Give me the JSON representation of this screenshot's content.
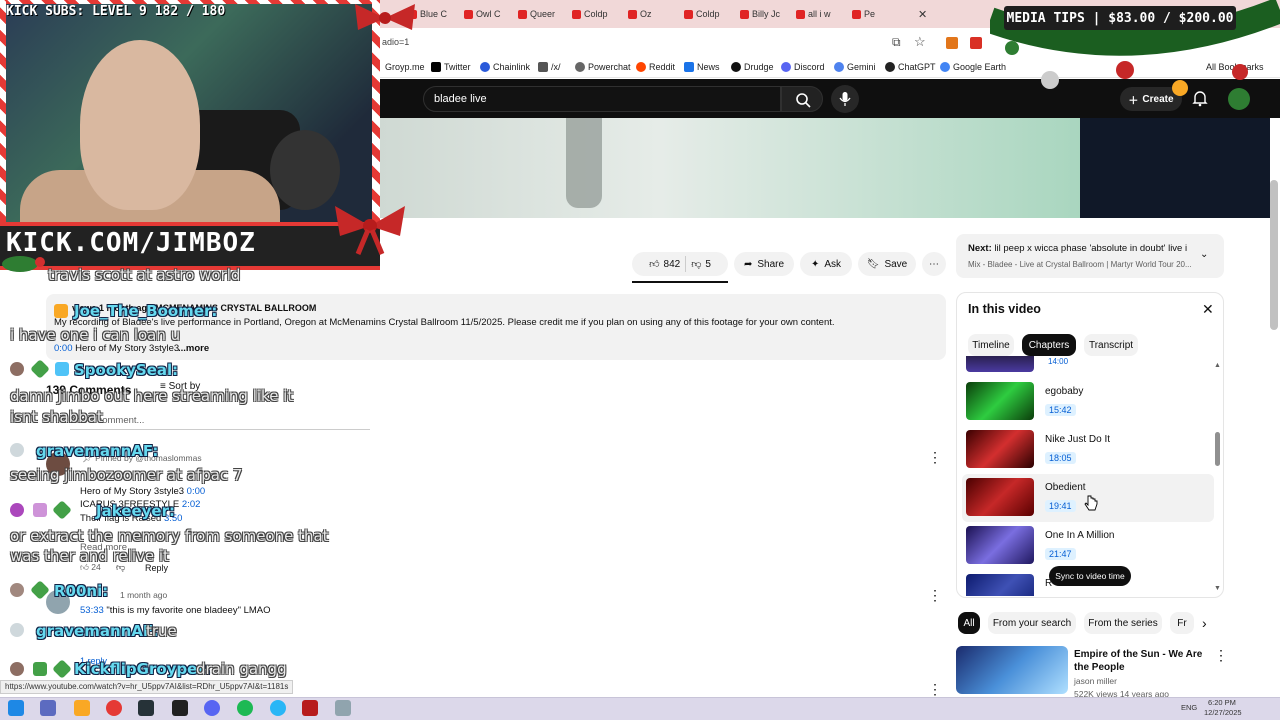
{
  "stream_overlay": {
    "kick_subs": "KICK SUBS: LEVEL 9 182 / 180",
    "banner_url": "KICK.COM/JIMBOZ",
    "media_tips": "MEDIA TIPS | $83.00 / $200.00"
  },
  "browser": {
    "tabs": [
      "Blue C",
      "Owl C",
      "Queer",
      "Coldp",
      "Oz",
      "Coldp",
      "Billy Jc",
      "all i w",
      "Pe"
    ],
    "address_fragment": "adio=1",
    "bookmarks": [
      "Groyp.me",
      "Twitter",
      "Chainlink",
      "/x/",
      "Powerchat",
      "Reddit",
      "News",
      "Drudge",
      "Discord",
      "Gemini",
      "ChatGPT",
      "Google Earth",
      "All Bookmarks"
    ],
    "status_url": "https://www.youtube.com/watch?v=hr_U5ppv7AI&list=RDhr_U5ppv7AI&t=1181s"
  },
  "youtube": {
    "search_value": "bladee live",
    "create_label": "Create",
    "actions": {
      "likes": "842",
      "dislikes": "5",
      "share": "Share",
      "ask": "Ask",
      "save": "Save"
    },
    "description": {
      "header": "views  1 month ago  MCMENAMINS CRYSTAL BALLROOM",
      "line1": "My recording of Bladee's live performance in Portland, Oregon at McMenamins Crystal Ballroom 11/5/2025. Please credit me if you plan on using any of this footage for your own content.",
      "timestamp": "0:00",
      "track": "Hero of My Story 3style3",
      "more": "...more"
    },
    "comments_header": {
      "count": "139 Comments",
      "sort": "Sort by",
      "add_placeholder": "Add a comment..."
    },
    "comments": [
      {
        "pinned": "Pinned by @thomaslommas",
        "lines": [
          {
            "text": "Hero of My Story 3style3 ",
            "time": "0:00"
          },
          {
            "text": "ICARUS 3FREESTYLE ",
            "time": "2:02"
          },
          {
            "text": "Their flag is Raised ",
            "time": "3:50"
          }
        ],
        "read_more": "Read more",
        "likes": "24",
        "reply": "Reply"
      },
      {
        "meta": "1 month ago",
        "time": "53:33",
        "text": "\"this is my favorite one bladeey\" LMAO",
        "replies": "1 reply"
      }
    ],
    "up_next": {
      "prefix": "Next:",
      "title": "lil peep x wicca phase 'absolute in doubt' live i...",
      "subtitle": "Mix - Bladee - Live at Crystal Ballroom | Martyr World Tour 20..."
    },
    "panel": {
      "title": "In this video",
      "tabs": [
        "Timeline",
        "Chapters",
        "Transcript"
      ],
      "active_tab": "Chapters",
      "top_partial_time": "14:00",
      "chapters": [
        {
          "title": "egobaby",
          "time": "15:42"
        },
        {
          "title": "Nike Just Do It",
          "time": "18:05"
        },
        {
          "title": "Obedient",
          "time": "19:41"
        },
        {
          "title": "One In A Million",
          "time": "21:47"
        },
        {
          "title": "R",
          "time": ""
        }
      ],
      "sync_tooltip": "Sync to video time"
    },
    "filter_chips": [
      "All",
      "From your search",
      "From the series",
      "Fr"
    ],
    "recommendation": {
      "title": "Empire of the Sun - We Are the People",
      "channel": "jason miller",
      "meta": "522K views  14 years ago"
    }
  },
  "chat_overlay": [
    {
      "user": "",
      "text": "travis scott at astro world"
    },
    {
      "user": "Joe_The_Boomer:",
      "text": "i have one i can loan u"
    },
    {
      "user": "SpookySeal:",
      "text": "damn Jimbo out here streaming like it isnt shabbat"
    },
    {
      "user": "gravemannAF:",
      "text": "seeing jimbozoomer at afpac 7"
    },
    {
      "user": "Jakeeyer:",
      "text": "or extract the memory from someone that was ther and relive it"
    },
    {
      "user": "R00ni:",
      "text": ""
    },
    {
      "user": "gravemannAF:",
      "text": "true"
    },
    {
      "user": "KickflipGroyper:",
      "text": "drain gangg"
    }
  ],
  "taskbar": {
    "lang": "ENG",
    "time": "6:20 PM",
    "date": "12/27/2025"
  }
}
